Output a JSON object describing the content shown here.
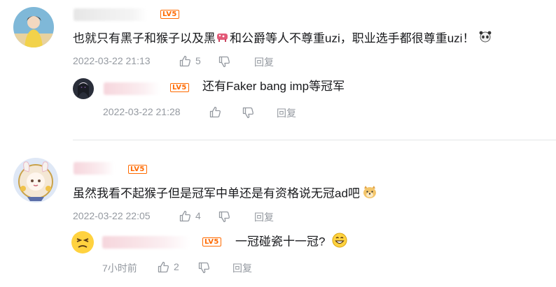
{
  "comments": [
    {
      "content": "也就只有黑子和猴子以及黑",
      "content_after": "和公爵等人不尊重uzi，职业选手都很尊重uzi！",
      "level": "LV5",
      "time": "2022-03-22 21:13",
      "likes": "5",
      "reply_label": "回复",
      "reply": {
        "content": "还有Faker bang imp等冠军",
        "level": "LV5",
        "time": "2022-03-22 21:28",
        "likes": "",
        "reply_label": "回复"
      }
    },
    {
      "content": "虽然我看不起猴子但是冠军中单还是有资格说无冠ad吧",
      "level": "LV5",
      "time": "2022-03-22 22:05",
      "likes": "4",
      "reply_label": "回复",
      "reply": {
        "content": "一冠碰瓷十一冠?",
        "level": "LV5",
        "time": "7小时前",
        "likes": "2",
        "reply_label": "回复"
      }
    }
  ],
  "colors": {
    "level_badge": "#ff6a00",
    "meta_text": "#9499a0",
    "divider": "#e3e5e7"
  }
}
